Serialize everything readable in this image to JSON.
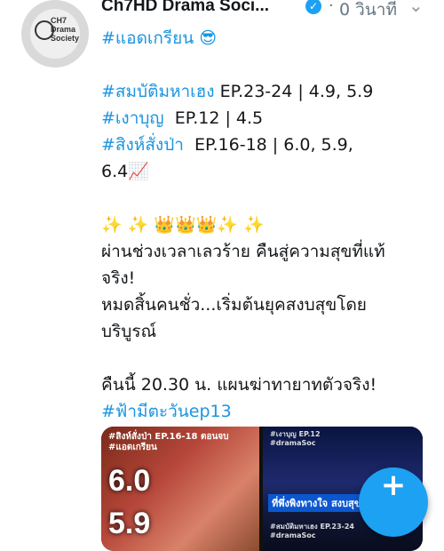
{
  "tweet": {
    "author": "Ch7HD Drama Soci...",
    "separator": "·",
    "time": "0 วินาที",
    "lines": [
      {
        "kind": "tag",
        "text": "#แอดเกรียน 😎"
      },
      {
        "kind": "blank"
      },
      {
        "kind": "mixed",
        "tag": "#สมบัติมหาเฮง",
        "rest": " EP.23-24 | 4.9, 5.9"
      },
      {
        "kind": "mixed",
        "tag": "#เงาบุญ",
        "rest": "  EP.12 | 4.5"
      },
      {
        "kind": "mixed",
        "tag": "#สิงห์สั่งป่า",
        "rest": "  EP.16-18 | 6.0, 5.9,"
      },
      {
        "kind": "text",
        "text": "6.4📈"
      },
      {
        "kind": "blank"
      },
      {
        "kind": "text",
        "text": "✨ ✨ 👑👑👑✨ ✨"
      },
      {
        "kind": "text",
        "text": "ผ่านช่วงเวลาเลวร้าย คืนสู่ความสุขที่แท้"
      },
      {
        "kind": "text",
        "text": "จริง!"
      },
      {
        "kind": "text",
        "text": "หมดสิ้นคนชั่ว...เริ่มต้นยุคสงบสุขโดย"
      },
      {
        "kind": "text",
        "text": "บริบูรณ์"
      },
      {
        "kind": "blank"
      },
      {
        "kind": "text",
        "text": "คืนนี้ 20.30 น. แผนฆ่าทายาทตัวจริง!"
      },
      {
        "kind": "tag",
        "text": "#ฟ้ามีตะวันep13"
      }
    ]
  },
  "avatar": {
    "brand": "CH7\nDrama\nSociety"
  },
  "media": {
    "image1": {
      "caption": "#สิงห์สั่งป่า EP.16-18 ตอนจบ\n#แอดเกรียน",
      "ratings": [
        "6.0",
        "5.9"
      ]
    },
    "image2": {
      "caption": "#เงาบุญ EP.12\n#dramaSoc",
      "banner": "ที่พึ่งพิงทางใจ สงบสุขบน",
      "sublabel": "#สมบัติมหาเฮง EP.23-24\n#dramaSoc"
    }
  },
  "icons": {
    "verified": "verified-badge-icon",
    "chevron": "chevron-down-icon",
    "compose": "compose-tweet-icon"
  },
  "colors": {
    "link": "#1b95e0",
    "accent": "#1da1f2",
    "text": "#14171a",
    "muted": "#657786"
  }
}
